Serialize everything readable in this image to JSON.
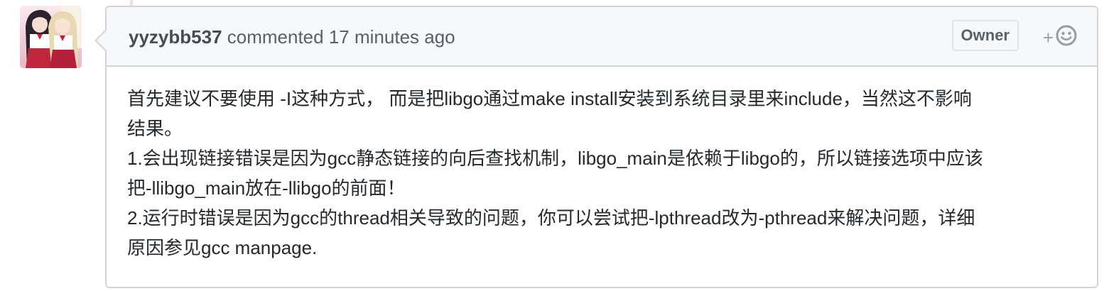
{
  "comment": {
    "author": "yyzybb537",
    "action": "commented",
    "timestamp": "17 minutes ago",
    "badge": "Owner",
    "reaction_plus": "+",
    "reaction_icon": "smiley-icon",
    "body_lines": [
      "首先建议不要使用 -I这种方式， 而是把libgo通过make install安装到系统目录里来include，当然这不影响",
      "结果。",
      "1.会出现链接错误是因为gcc静态链接的向后查找机制，libgo_main是依赖于libgo的，所以链接选项中应该",
      "把-llibgo_main放在-llibgo的前面！",
      "2.运行时错误是因为gcc的thread相关导致的问题，你可以尝试把-lpthread改为-pthread来解决问题，详细",
      "原因参见gcc manpage."
    ]
  },
  "colors": {
    "border": "#d1d5da",
    "header_bg": "#f6f8fa",
    "muted_text": "#586069",
    "body_text": "#24292e"
  }
}
